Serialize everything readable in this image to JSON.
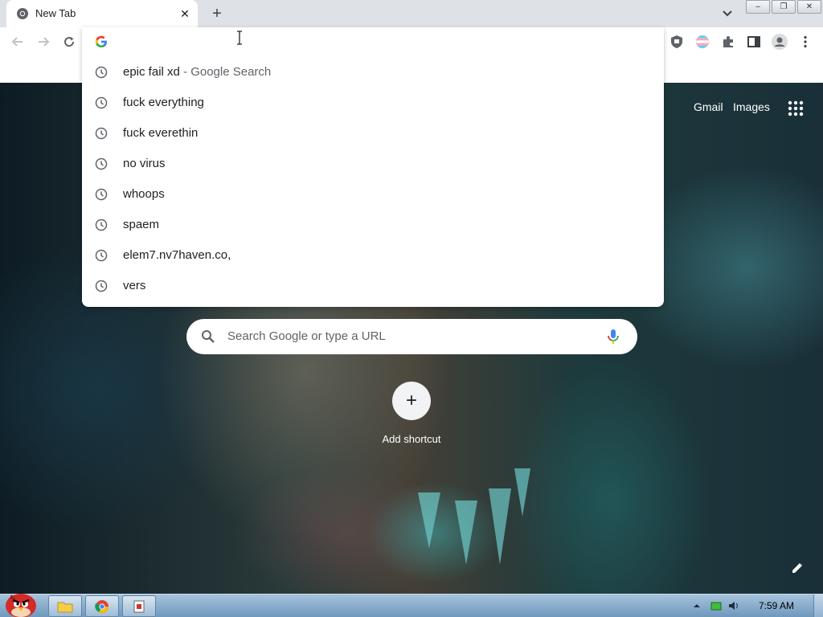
{
  "tab": {
    "title": "New Tab",
    "close": "✕"
  },
  "tabstrip": {
    "new_tab": "+"
  },
  "window_controls": {
    "minimize": "–",
    "restore": "❐",
    "close": "✕"
  },
  "omnibox": {
    "value": "",
    "suggestions": [
      {
        "text": "epic fail xd",
        "desc": " - Google Search"
      },
      {
        "text": "fuck everything",
        "desc": ""
      },
      {
        "text": "fuck everethin",
        "desc": ""
      },
      {
        "text": "no virus",
        "desc": ""
      },
      {
        "text": "whoops",
        "desc": ""
      },
      {
        "text": "spaem",
        "desc": ""
      },
      {
        "text": "elem7.nv7haven.co,",
        "desc": ""
      },
      {
        "text": "vers",
        "desc": ""
      }
    ]
  },
  "ntp": {
    "links": {
      "gmail": "Gmail",
      "images": "Images"
    },
    "search_placeholder": "Search Google or type a URL",
    "add_shortcut_label": "Add shortcut",
    "add_shortcut_symbol": "+"
  },
  "taskbar": {
    "time": "7:59 AM"
  },
  "colors": {
    "accent_blue": "#1a73e8",
    "chrome_tabstrip": "#dee1e6",
    "taskbar": "#6f98bd"
  }
}
